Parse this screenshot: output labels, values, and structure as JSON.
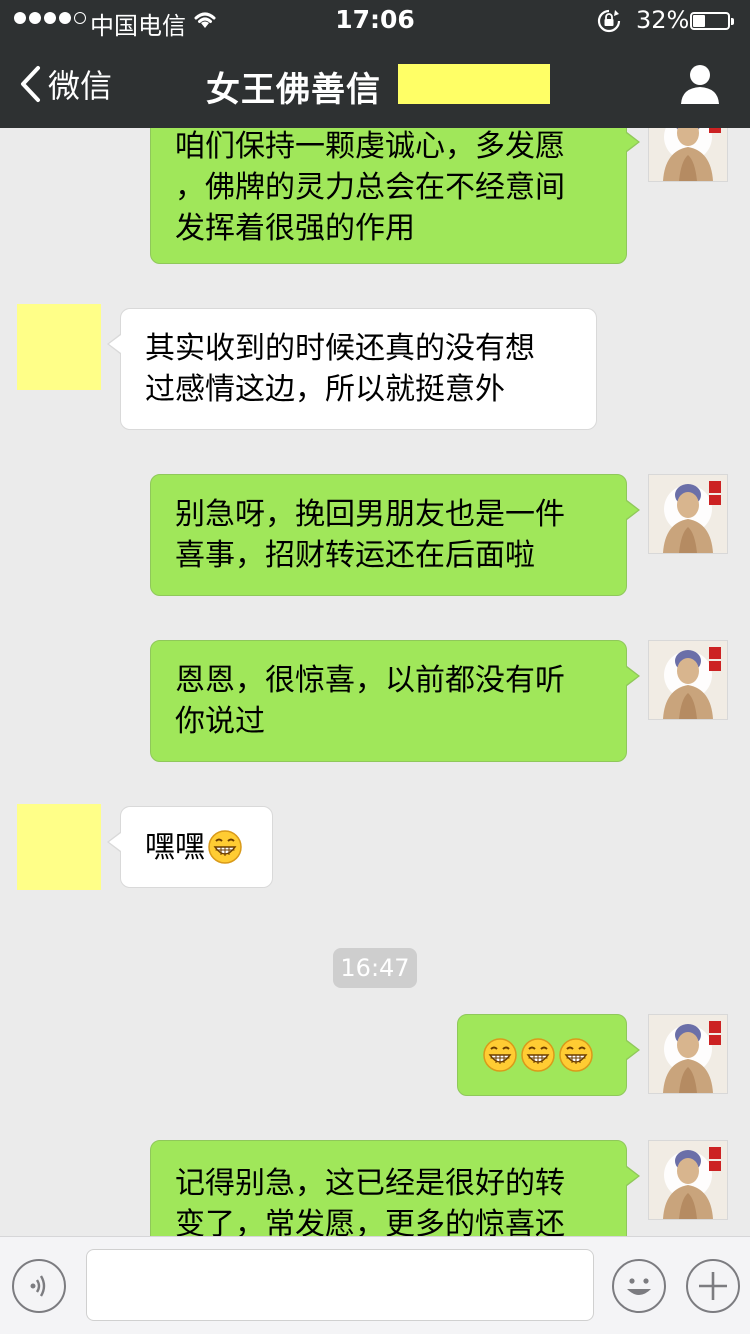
{
  "status_bar": {
    "carrier": "中国电信",
    "time": "17:06",
    "battery_percent": "32%",
    "battery_level": 0.32
  },
  "nav": {
    "back_label": "微信",
    "title": "女王佛善信"
  },
  "messages": [
    {
      "id": "m1",
      "from": "me",
      "text": "咱们保持一颗虔诚心，多发愿\n，佛牌的灵力总会在不经意间\n发挥着很强的作用"
    },
    {
      "id": "m2",
      "from": "other",
      "text": "其实收到的时候还真的没有想\n过感情这边，所以就挺意外"
    },
    {
      "id": "m3",
      "from": "me",
      "text": "别急呀，挽回男朋友也是一件\n喜事，招财转运还在后面啦"
    },
    {
      "id": "m4",
      "from": "me",
      "text": "恩恩，很惊喜，以前都没有听\n你说过"
    },
    {
      "id": "m5",
      "from": "other",
      "text": "嘿嘿",
      "emoji": "grin-emoji"
    },
    {
      "id": "m6",
      "from": "me",
      "text": "",
      "emojis": [
        "grin-emoji",
        "grin-emoji",
        "grin-emoji"
      ]
    },
    {
      "id": "m7",
      "from": "me",
      "text": "记得别急，这已经是很好的转\n变了，常发愿，更多的惊喜还"
    }
  ],
  "timestamp": "16:47",
  "input_bar": {
    "placeholder": "",
    "icons": [
      "voice-icon",
      "emoji-face-icon",
      "plus-icon"
    ]
  },
  "colors": {
    "nav_background": "#2e3132",
    "chat_background": "#ebebeb",
    "my_bubble": "#a0e75a",
    "other_bubble": "#ffffff",
    "redaction": "#ffff66"
  }
}
